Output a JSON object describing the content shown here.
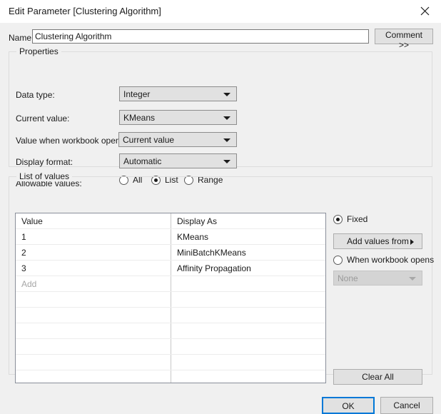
{
  "window": {
    "title": "Edit Parameter [Clustering Algorithm]",
    "close_icon": "close-icon"
  },
  "name_row": {
    "label": "Name:",
    "value": "Clustering Algorithm",
    "placeholder": "",
    "comment_button": "Comment >>"
  },
  "properties": {
    "legend": "Properties",
    "rows": [
      {
        "label": "Data type:",
        "value": "Integer"
      },
      {
        "label": "Current value:",
        "value": "KMeans"
      },
      {
        "label": "Value when workbook opens:",
        "value": "Current value"
      },
      {
        "label": "Display format:",
        "value": "Automatic"
      }
    ],
    "allowable": {
      "label": "Allowable values:",
      "options": [
        {
          "label": "All",
          "checked": false
        },
        {
          "label": "List",
          "checked": true
        },
        {
          "label": "Range",
          "checked": false
        }
      ]
    }
  },
  "list_of_values": {
    "legend": "List of values",
    "columns": [
      "Value",
      "Display As"
    ],
    "rows": [
      {
        "value": "1",
        "display_as": "KMeans"
      },
      {
        "value": "2",
        "display_as": "MiniBatchKMeans"
      },
      {
        "value": "3",
        "display_as": "Affinity Propagation"
      }
    ],
    "add_placeholder": "Add",
    "empty_row_count": 7
  },
  "side_panel": {
    "fixed_radio": {
      "label": "Fixed",
      "checked": true
    },
    "add_values_from_button": "Add values from",
    "when_workbook_opens_radio": {
      "label": "When workbook opens",
      "checked": false
    },
    "source_select": {
      "value": "None",
      "disabled": true
    },
    "clear_all_button": "Clear All"
  },
  "footer": {
    "ok_button": "OK",
    "cancel_button": "Cancel"
  },
  "colors": {
    "dialog_background": "#f0f0f0",
    "titlebar_background": "#ffffff",
    "control_face": "#e1e1e1",
    "focus_accent": "#0078d7",
    "field_background": "#ffffff",
    "text": "#1b1b1b",
    "disabled_text": "#9a9a9a"
  }
}
